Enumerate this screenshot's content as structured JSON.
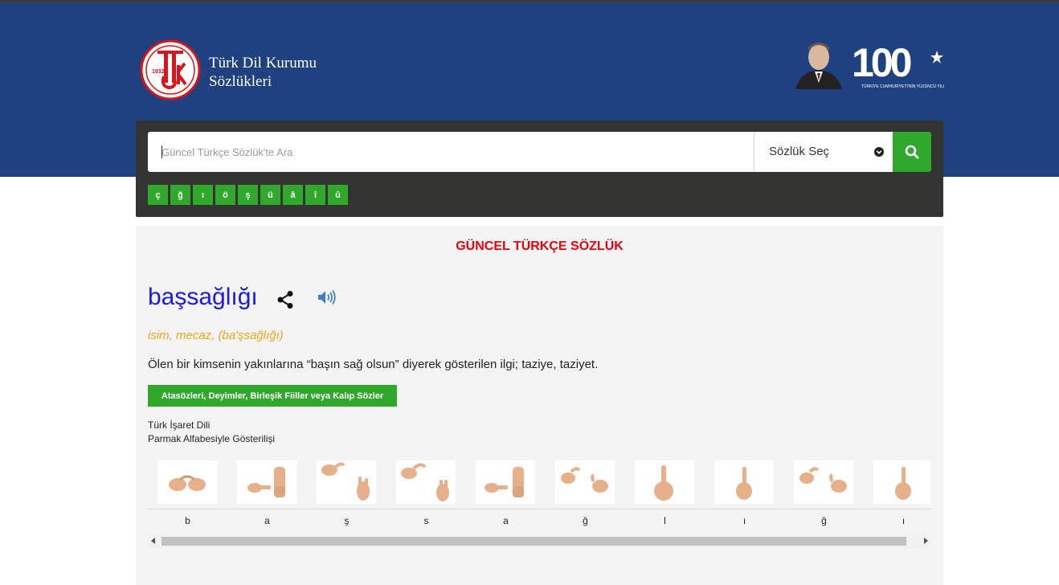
{
  "header": {
    "brand_line1": "Türk Dil Kurumu",
    "brand_line2": "Sözlükleri",
    "logo_year": "1932",
    "logo_icon": "tdk-logo-icon",
    "anniversary_number": "100",
    "anniversary_caption": "TÜRKİYE CUMHURİYETİ'NİN YÜZÜNCÜ YILI"
  },
  "search": {
    "placeholder": "Güncel Türkçe Sözlük'te Ara",
    "value": "",
    "dictionary_select": "Sözlük Seç",
    "button_icon": "search-icon",
    "special_chars": [
      "ç",
      "ğ",
      "ı",
      "ö",
      "ş",
      "ü",
      "â",
      "î",
      "û"
    ]
  },
  "result": {
    "dictionary_title": "GÜNCEL TÜRKÇE SÖZLÜK",
    "headword": "başsağlığı",
    "share_icon": "share-icon",
    "sound_icon": "speaker-icon",
    "part_of_speech": "isim, mecaz, (ba'şsağlığı)",
    "definition": "Ölen bir kimsenin yakınlarına “başın sağ olsun” diyerek gösterilen ilgi; taziye, taziyet.",
    "idioms_button": "Atasözleri, Deyimler, Birleşik Fiiller veya Kalıp Sözler",
    "sign_language_line1": "Türk İşaret Dili",
    "sign_language_line2": "Parmak Alfabesiyle Gösterilişi",
    "finger_spelling": [
      "b",
      "a",
      "ş",
      "s",
      "a",
      "ğ",
      "l",
      "ı",
      "ğ",
      "ı"
    ]
  },
  "colors": {
    "header_bg": "#1f4180",
    "panel_bg": "#333431",
    "accent_green": "#2fa82b",
    "title_red": "#e8000c",
    "headword_blue": "#1a1ae0",
    "pos_orange": "#f0a41f"
  }
}
